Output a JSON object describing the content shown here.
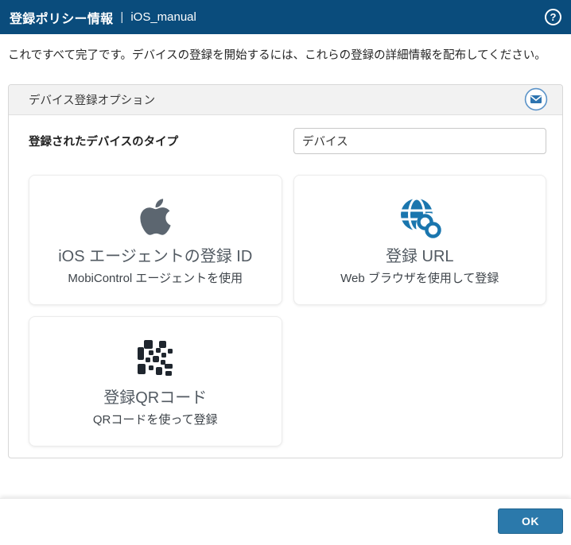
{
  "titlebar": {
    "title": "登録ポリシー情報",
    "separator": "|",
    "policy_name": "iOS_manual",
    "help_icon": "circled-question-mark",
    "help_glyph": "?",
    "bg_color": "#0a4c7c"
  },
  "intro_text": "これですべて完了です。デバイスの登録を開始するには、これらの登録の詳細情報を配布してください。",
  "panel": {
    "header": {
      "title": "デバイス登録オプション",
      "mail_icon": "envelope-in-circle"
    },
    "device_type_field": {
      "label": "登録されたデバイスのタイプ",
      "value": "デバイス"
    },
    "cards": [
      {
        "icon": "apple-logo",
        "title": "iOS エージェントの登録 ID",
        "subtitle": "MobiControl エージェントを使用"
      },
      {
        "icon": "globe-link",
        "title": "登録 URL",
        "subtitle": "Web ブラウザを使用して登録"
      },
      {
        "icon": "qr-code",
        "title": "登録QRコード",
        "subtitle": "QRコードを使って登録"
      }
    ]
  },
  "footer": {
    "ok_label": "OK"
  },
  "colors": {
    "titlebar_bg": "#0a4c7c",
    "accent_blue": "#1a76ae",
    "ok_button_bg": "#2b79ab",
    "panel_header_bg": "#f2f2f2",
    "apple_gray": "#5c6670",
    "qr_dark": "#1f262e",
    "card_title": "#525a62"
  }
}
